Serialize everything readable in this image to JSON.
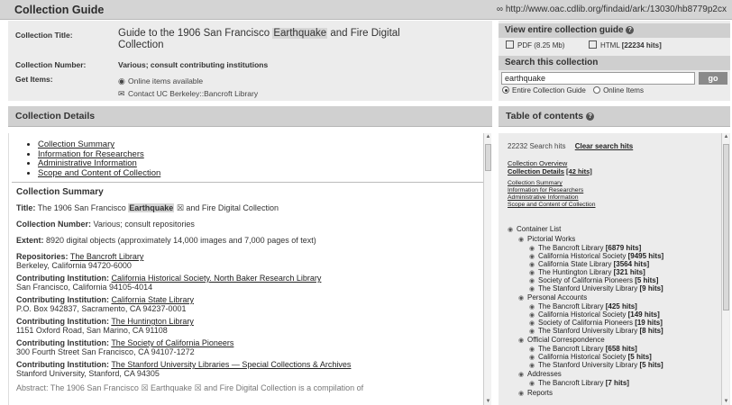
{
  "header": {
    "title": "Collection Guide",
    "url": "∞ http://www.oac.cdlib.org/findaid/ark:/13030/hb8779p2cx"
  },
  "meta": {
    "title_label": "Collection Title:",
    "title_before": "Guide to the 1906 San Francisco",
    "title_highlight": "Earthquake",
    "title_after": "and Fire Digital",
    "title_line2": "Collection",
    "number_label": "Collection Number:",
    "number_value": "Various; consult contributing institutions",
    "get_label": "Get Items:",
    "get_online": "Online items available",
    "get_contact": "Contact UC Berkeley::Bancroft Library"
  },
  "view_guide": {
    "heading": "View entire collection guide",
    "pdf_label": "PDF",
    "pdf_size": "(8.25 Mb)",
    "html_label": "HTML",
    "html_size": "[22234 hits]"
  },
  "search": {
    "heading": "Search this collection",
    "value": "earthquake",
    "go": "go",
    "radio_entire": "Entire Collection Guide",
    "radio_online": "Online Items"
  },
  "details": {
    "heading": "Collection Details",
    "toc_links": [
      "Collection Summary",
      "Information for Researchers",
      "Administrative Information",
      "Scope and Content of Collection"
    ],
    "summary_heading": "Collection Summary",
    "title_label": "Title:",
    "title_text_before": "The 1906 San Francisco",
    "title_text_highlight": "Earthquake",
    "title_text_after": "and Fire Digital Collection",
    "number_label": "Collection Number:",
    "number_text": "Various; consult repositories",
    "extent_label": "Extent:",
    "extent_text": "8920 digital objects (approximately 14,000 images and 7,000 pages of text)",
    "repo_label": "Repositories:",
    "repo_link": "The Bancroft Library",
    "repo_addr": "Berkeley, California 94720-6000",
    "contrib_label": "Contributing Institution:",
    "contribs": [
      {
        "name": "California Historical Society. North Baker Research Library",
        "addr": "San Francisco, California 94105-4014"
      },
      {
        "name": "California State Library",
        "addr": "P.O. Box 942837, Sacramento, CA 94237-0001"
      },
      {
        "name": "The Huntington Library",
        "addr": "1151 Oxford Road, San Marino, CA 91108"
      },
      {
        "name": "The Society of California Pioneers",
        "addr": "300 Fourth Street San Francisco, CA 94107-1272"
      },
      {
        "name": "The Stanford University Libraries — Special Collections & Archives",
        "addr": "Stanford University, Stanford, CA 94305"
      }
    ],
    "abstract_partial": "Abstract: The 1906 San Francisco ☒ Earthquake ☒ and Fire Digital Collection is a compilation of"
  },
  "toc": {
    "heading": "Table of contents",
    "hits": "22232 Search hits",
    "clear": "Clear search hits",
    "overview": "Collection Overview",
    "details_label": "Collection Details",
    "details_hits": "[42 hits]",
    "sub_links": [
      "Collection Summary",
      "Information for Researchers",
      "Administrative Information",
      "Scope and Content of Collection"
    ],
    "container": "Container List",
    "groups": [
      {
        "label": "Pictorial Works",
        "items": [
          {
            "name": "The Bancroft Library",
            "hits": "[6879 hits]"
          },
          {
            "name": "California Historical Society",
            "hits": "[9495 hits]"
          },
          {
            "name": "California State Library",
            "hits": "[3564 hits]"
          },
          {
            "name": "The Huntington Library",
            "hits": "[321 hits]"
          },
          {
            "name": "Society of California Pioneers",
            "hits": "[5 hits]"
          },
          {
            "name": "The Stanford University Library",
            "hits": "[9 hits]"
          }
        ]
      },
      {
        "label": "Personal Accounts",
        "items": [
          {
            "name": "The Bancroft Library",
            "hits": "[425 hits]"
          },
          {
            "name": "California Historical Society",
            "hits": "[149 hits]"
          },
          {
            "name": "Society of California Pioneers",
            "hits": "[19 hits]"
          },
          {
            "name": "The Stanford University Library",
            "hits": "[8 hits]"
          }
        ]
      },
      {
        "label": "Official Correspondence",
        "items": [
          {
            "name": "The Bancroft Library",
            "hits": "[658 hits]"
          },
          {
            "name": "California Historical Society",
            "hits": "[5 hits]"
          },
          {
            "name": "The Stanford University Library",
            "hits": "[5 hits]"
          }
        ]
      },
      {
        "label": "Addresses",
        "items": [
          {
            "name": "The Bancroft Library",
            "hits": "[7 hits]"
          }
        ]
      },
      {
        "label": "Reports",
        "items": []
      }
    ]
  }
}
